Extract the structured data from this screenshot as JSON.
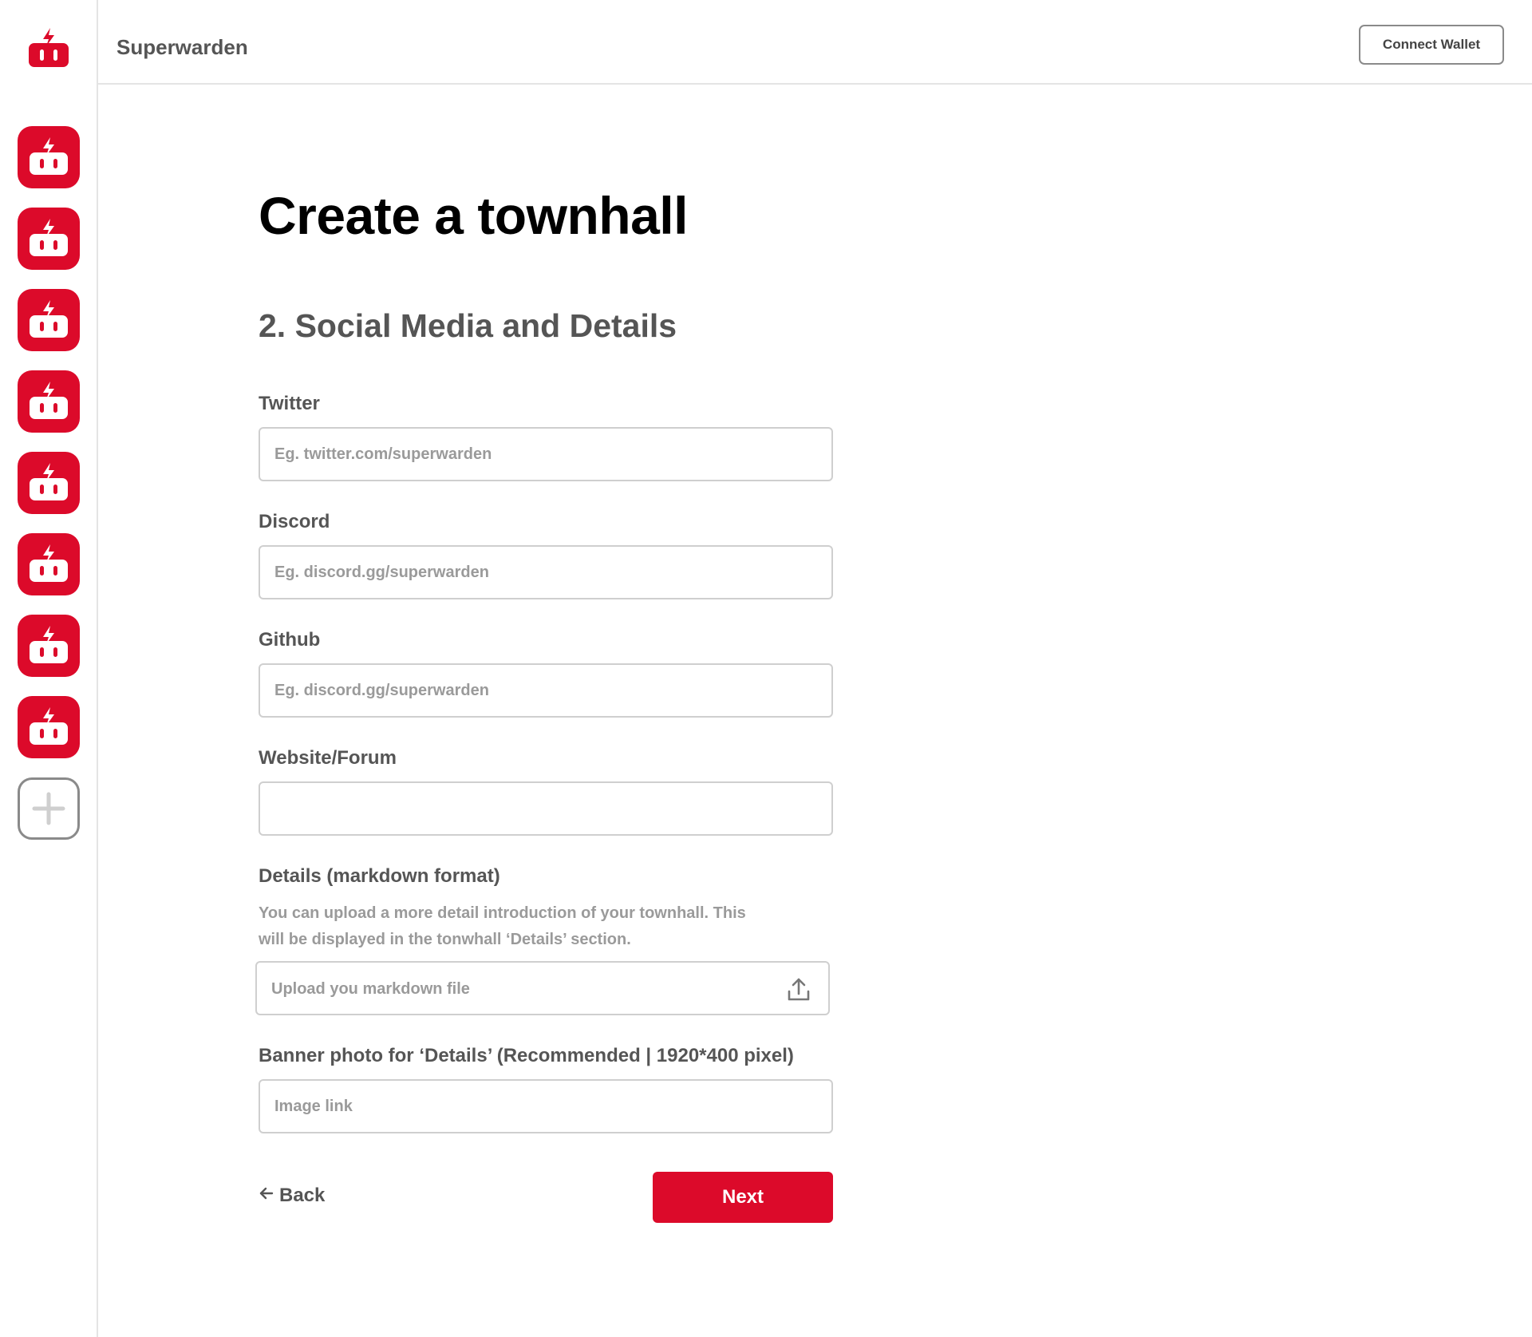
{
  "app": {
    "name": "Superwarden",
    "brand_color": "#dc0a2a"
  },
  "header": {
    "connect_wallet_label": "Connect Wallet"
  },
  "sidebar": {
    "logo_icon": "robot-lightning-icon",
    "dao_count": 8,
    "dao_icon": "robot-lightning-icon",
    "add_icon": "plus-icon"
  },
  "form": {
    "page_title": "Create a townhall",
    "section_title": "2. Social Media and Details",
    "twitter": {
      "label": "Twitter",
      "placeholder": "Eg. twitter.com/superwarden",
      "value": ""
    },
    "discord": {
      "label": "Discord",
      "placeholder": "Eg. discord.gg/superwarden",
      "value": ""
    },
    "github": {
      "label": "Github",
      "placeholder": "Eg. discord.gg/superwarden",
      "value": ""
    },
    "website": {
      "label": "Website/Forum",
      "placeholder": "",
      "value": ""
    },
    "details": {
      "label": "Details (markdown format)",
      "help_line1": "You can upload a more detail introduction of your townhall. This",
      "help_line2": "will be displayed in the tonwhall ‘Details’ section.",
      "upload_placeholder": "Upload you markdown file",
      "upload_icon": "upload-icon"
    },
    "banner": {
      "label": "Banner photo for ‘Details’ (Recommended | 1920*400 pixel)",
      "placeholder": "Image link",
      "value": ""
    },
    "back_label": "Back",
    "back_icon": "arrow-left-icon",
    "next_label": "Next"
  }
}
